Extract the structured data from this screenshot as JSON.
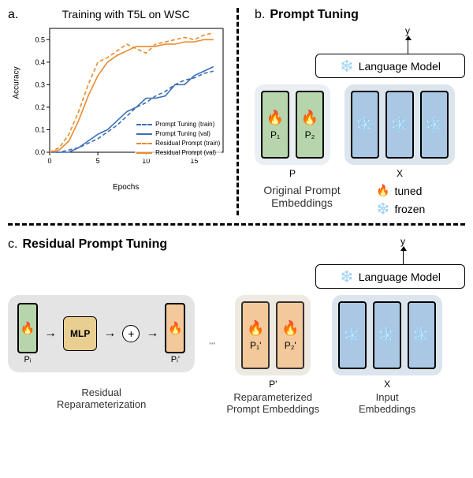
{
  "panel_a": {
    "label": "a.",
    "chart_title": "Training with T5L on WSC",
    "ylabel": "Accuracy",
    "xlabel": "Epochs",
    "legend": {
      "pt_train": "Prompt Tuning (train)",
      "pt_val": "Prompt Tuning (val)",
      "rp_train": "Residual Prompt (train)",
      "rp_val": "Residual Prompt (val)"
    }
  },
  "panel_b": {
    "label": "b.",
    "title": "Prompt Tuning",
    "lm_label": "Language Model",
    "p1": "P₁",
    "p2": "P₂",
    "p_label": "P",
    "x_label": "X",
    "caption": "Original Prompt\nEmbeddings",
    "tuned": "tuned",
    "frozen": "frozen",
    "y": "y"
  },
  "panel_c": {
    "label": "c.",
    "title": "Residual Prompt Tuning",
    "lm_label": "Language Model",
    "mlp": "MLP",
    "pi": "Pᵢ",
    "pi_prime": "Pᵢ'",
    "p1p": "P₁'",
    "p2p": "P₂'",
    "pprime": "P'",
    "x_label": "X",
    "residual_caption": "Residual\nReparameterization",
    "reparam_caption": "Reparameterized\nPrompt Embeddings",
    "input_caption": "Input\nEmbeddings",
    "y": "y"
  },
  "chart_data": {
    "type": "line",
    "title": "Training with T5L on WSC",
    "xlabel": "Epochs",
    "ylabel": "Accuracy",
    "xlim": [
      0,
      18
    ],
    "ylim": [
      0.0,
      0.55
    ],
    "series": [
      {
        "name": "Prompt Tuning (train)",
        "color": "#3b6fb5",
        "style": "dashed",
        "x": [
          0,
          1,
          2,
          3,
          4,
          5,
          6,
          7,
          8,
          9,
          10,
          11,
          12,
          13,
          14,
          15,
          16,
          17
        ],
        "y": [
          0.0,
          0.0,
          0.01,
          0.02,
          0.04,
          0.06,
          0.09,
          0.12,
          0.16,
          0.2,
          0.22,
          0.25,
          0.27,
          0.3,
          0.32,
          0.33,
          0.35,
          0.36
        ]
      },
      {
        "name": "Prompt Tuning (val)",
        "color": "#3b6fb5",
        "style": "solid",
        "x": [
          0,
          1,
          2,
          3,
          4,
          5,
          6,
          7,
          8,
          9,
          10,
          11,
          12,
          13,
          14,
          15,
          16,
          17
        ],
        "y": [
          0.0,
          0.0,
          0.0,
          0.02,
          0.05,
          0.08,
          0.1,
          0.14,
          0.18,
          0.2,
          0.24,
          0.24,
          0.25,
          0.3,
          0.3,
          0.34,
          0.36,
          0.38
        ]
      },
      {
        "name": "Residual Prompt (train)",
        "color": "#e88b2e",
        "style": "dashed",
        "x": [
          0,
          1,
          2,
          3,
          4,
          5,
          6,
          7,
          8,
          9,
          10,
          11,
          12,
          13,
          14,
          15,
          16,
          17
        ],
        "y": [
          0.0,
          0.02,
          0.08,
          0.18,
          0.3,
          0.4,
          0.42,
          0.45,
          0.48,
          0.46,
          0.44,
          0.48,
          0.49,
          0.5,
          0.51,
          0.5,
          0.52,
          0.53
        ]
      },
      {
        "name": "Residual Prompt (val)",
        "color": "#e88b2e",
        "style": "solid",
        "x": [
          0,
          1,
          2,
          3,
          4,
          5,
          6,
          7,
          8,
          9,
          10,
          11,
          12,
          13,
          14,
          15,
          16,
          17
        ],
        "y": [
          0.0,
          0.01,
          0.05,
          0.14,
          0.25,
          0.34,
          0.4,
          0.43,
          0.45,
          0.47,
          0.47,
          0.47,
          0.48,
          0.48,
          0.49,
          0.49,
          0.5,
          0.5
        ]
      }
    ]
  }
}
